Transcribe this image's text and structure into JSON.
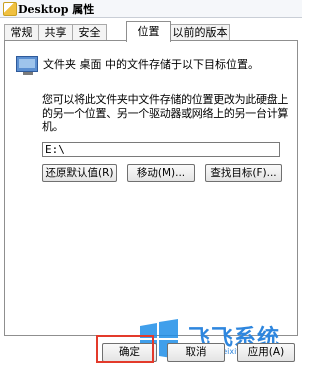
{
  "window": {
    "title": "Desktop 属性"
  },
  "tabs": [
    {
      "label": "常规"
    },
    {
      "label": "共享"
    },
    {
      "label": "安全"
    },
    {
      "label": "位置"
    },
    {
      "label": "以前的版本"
    }
  ],
  "location": {
    "info": "文件夹 桌面 中的文件存储于以下目标位置。",
    "description": "您可以将此文件夹中文件存储的位置更改为此硬盘上的另一个位置、另一个驱动器或网络上的另一台计算机。",
    "path_value": "E:\\",
    "restore_label": "还原默认值(R)",
    "move_label": "移动(M)...",
    "find_target_label": "查找目标(F)..."
  },
  "footer": {
    "ok_label": "确定",
    "cancel_label": "取消",
    "apply_label": "应用(A)"
  },
  "watermark": {
    "brand": "飞飞系统",
    "url": "www.feifeixitong.com"
  },
  "icons": {
    "title": "folder-icon",
    "location": "folder-location-icon",
    "watermark": "windows-logo-icon"
  }
}
